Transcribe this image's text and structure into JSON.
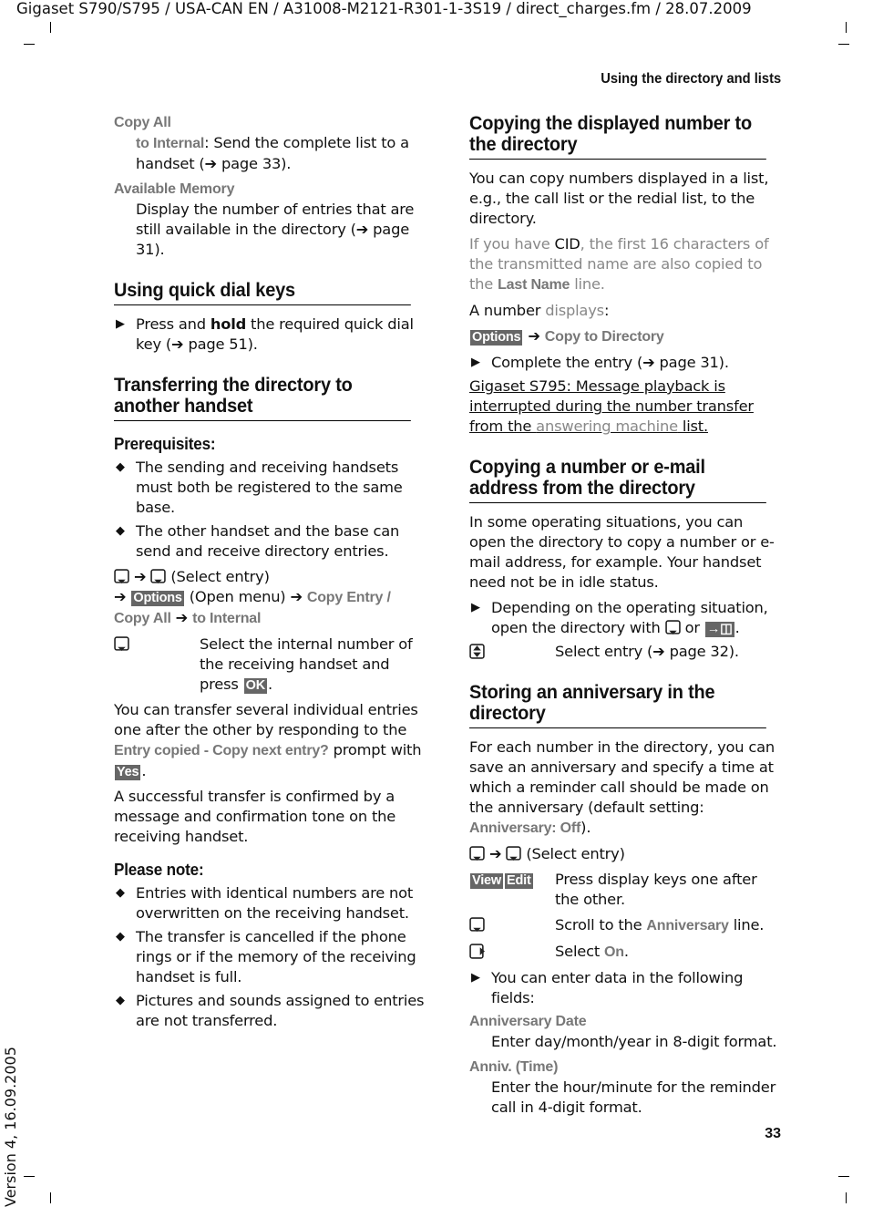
{
  "header": {
    "doc": "Gigaset S790/S795 / USA-CAN EN / A31008-M2121-R301-1-3S19 / direct_charges.fm / 28.07.2009",
    "running": "Using the directory and lists",
    "page_number": "33",
    "version": "Version 4, 16.09.2005"
  },
  "left": {
    "copy_all": "Copy All",
    "to_internal": "to Internal",
    "copy_all_desc": ": Send the complete list to a handset (➔ page 33).",
    "avail": "Available Memory",
    "avail_desc": "Display the number of entries that are still available in the directory (➔ page 31).",
    "h_quick": "Using quick dial keys",
    "quick_a": "Press and ",
    "quick_b": "hold",
    "quick_c": " the required quick dial key (➔ page 51).",
    "h_transfer": "Transferring the directory to another handset",
    "prereq": "Prerequisites:",
    "pre1": "The sending and receiving handsets must both be registered to the same base.",
    "pre2": "The other handset and the base can send and receive directory entries.",
    "sel_entry": "(Select entry)",
    "options": "Options",
    "open_menu": "(Open menu)",
    "copy_entry": "Copy Entry /",
    "copy_all2": "Copy All",
    "to_internal2": "to Internal",
    "sel_int": "Select the internal number of the receiving handset and press ",
    "ok": "OK",
    "several_a": "You can transfer several individual entries one after the other by responding to the ",
    "several_ui": "Entry copied - Copy next entry?",
    "several_b": " prompt with ",
    "yes": "Yes",
    "success": "A successful transfer is confirmed by a message and confirmation tone on the receiving handset.",
    "note": "Please note:",
    "n1": "Entries with identical numbers are not overwritten on the receiving handset.",
    "n2": "The transfer is cancelled if the phone rings or if the memory of the receiving handset is full.",
    "n3": "Pictures and sounds assigned to entries are not transferred."
  },
  "right": {
    "h_copy": "Copying the displayed number to the directory",
    "copy_p": "You can copy numbers displayed in a list, e.g., the call list or the redial list,  to the directory.",
    "cid_a": "If you have ",
    "cid": "CID",
    "cid_b": ", the first 16 characters of the transmitted name are also copied to the ",
    "last_name": "Last Name",
    "cid_c": " line.",
    "displays_a": "A number ",
    "displays_b": "displays",
    ":": ":",
    "options": "Options",
    "copy_dir": "Copy to Directory",
    "complete": "Complete the entry (➔ page 31).",
    "s795_a": "Gigaset S795: Message playback is interrupted during the number transfer from the ",
    "s795_b": "answering machine",
    "s795_c": " list.",
    "h_email": "Copying a number or e-mail address from the directory",
    "email_p": "In some operating situations, you can open the directory to copy a number or e-mail address, for example. Your handset need not be in idle status.",
    "depend": "Depending on the operating situation, open the directory with ",
    "or": " or ",
    "dir_key": "→◫",
    "sel_entry32": "Select entry (➔ page 32).",
    "h_anniv": "Storing an anniversary in the directory",
    "anniv_p": "For each number in the directory, you can save an anniversary and specify a time at which a reminder call should be made on the anniversary (default setting: ",
    "anniv_off": "Anniversary: Off",
    "anniv_end": ").",
    "sel_entry": "(Select entry)",
    "view": "View",
    "edit": "Edit",
    "press_keys": "Press display keys one after the other.",
    "scroll_a": "Scroll to the ",
    "anniversary": "Anniversary",
    "scroll_b": " line.",
    "select_a": "Select ",
    "on": "On",
    "dot": ".",
    "enter": "You can enter data in the following fields:",
    "date_l": "Anniversary Date",
    "date_d": "Enter day/month/year in 8-digit format.",
    "time_l": "Anniv. (Time)",
    "time_d": "Enter the hour/minute for the reminder call in 4-digit format."
  }
}
